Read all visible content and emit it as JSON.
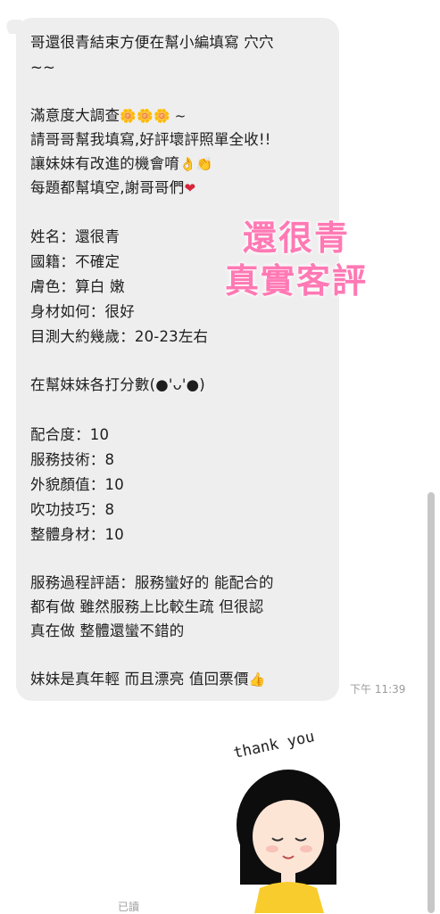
{
  "chat": {
    "lines": [
      "哥還很青結束方便在幫小編填寫 穴穴",
      "~~",
      "",
      "滿意度大調查",
      "請哥哥幫我填寫,好評壞評照單全收!!",
      "讓妹妹有改進的機會唷",
      "每題都幫填空,謝哥哥們",
      "",
      "姓名：還很青",
      "國籍：不確定",
      "膚色：算白 嫩",
      "身材如何：很好",
      "目測大約幾歲：20-23左右",
      "",
      "在幫妹妹各打分數(●'ᴗ'●)",
      "",
      "配合度：10",
      "服務技術：8",
      "外貌顏值：10",
      "吹功技巧：8",
      "整體身材：10",
      "",
      "服務過程評語：服務蠻好的 能配合的",
      "都有做 雖然服務上比較生疏 但很認",
      "真在做 整體還蠻不錯的",
      "",
      "妹妹是真年輕 而且漂亮 值回票價"
    ],
    "timestamp": "下午 11:39",
    "flower_emojis": "🌼🌼🌼 ~",
    "hand_emojis": "👌👏",
    "heart_emoji": "❤",
    "thumb_emoji": "👍"
  },
  "watermark": {
    "line1": "還很青",
    "line2": "真實客評"
  },
  "sticker": {
    "caption": "thank you"
  },
  "footer": {
    "small_text": "已讀"
  }
}
